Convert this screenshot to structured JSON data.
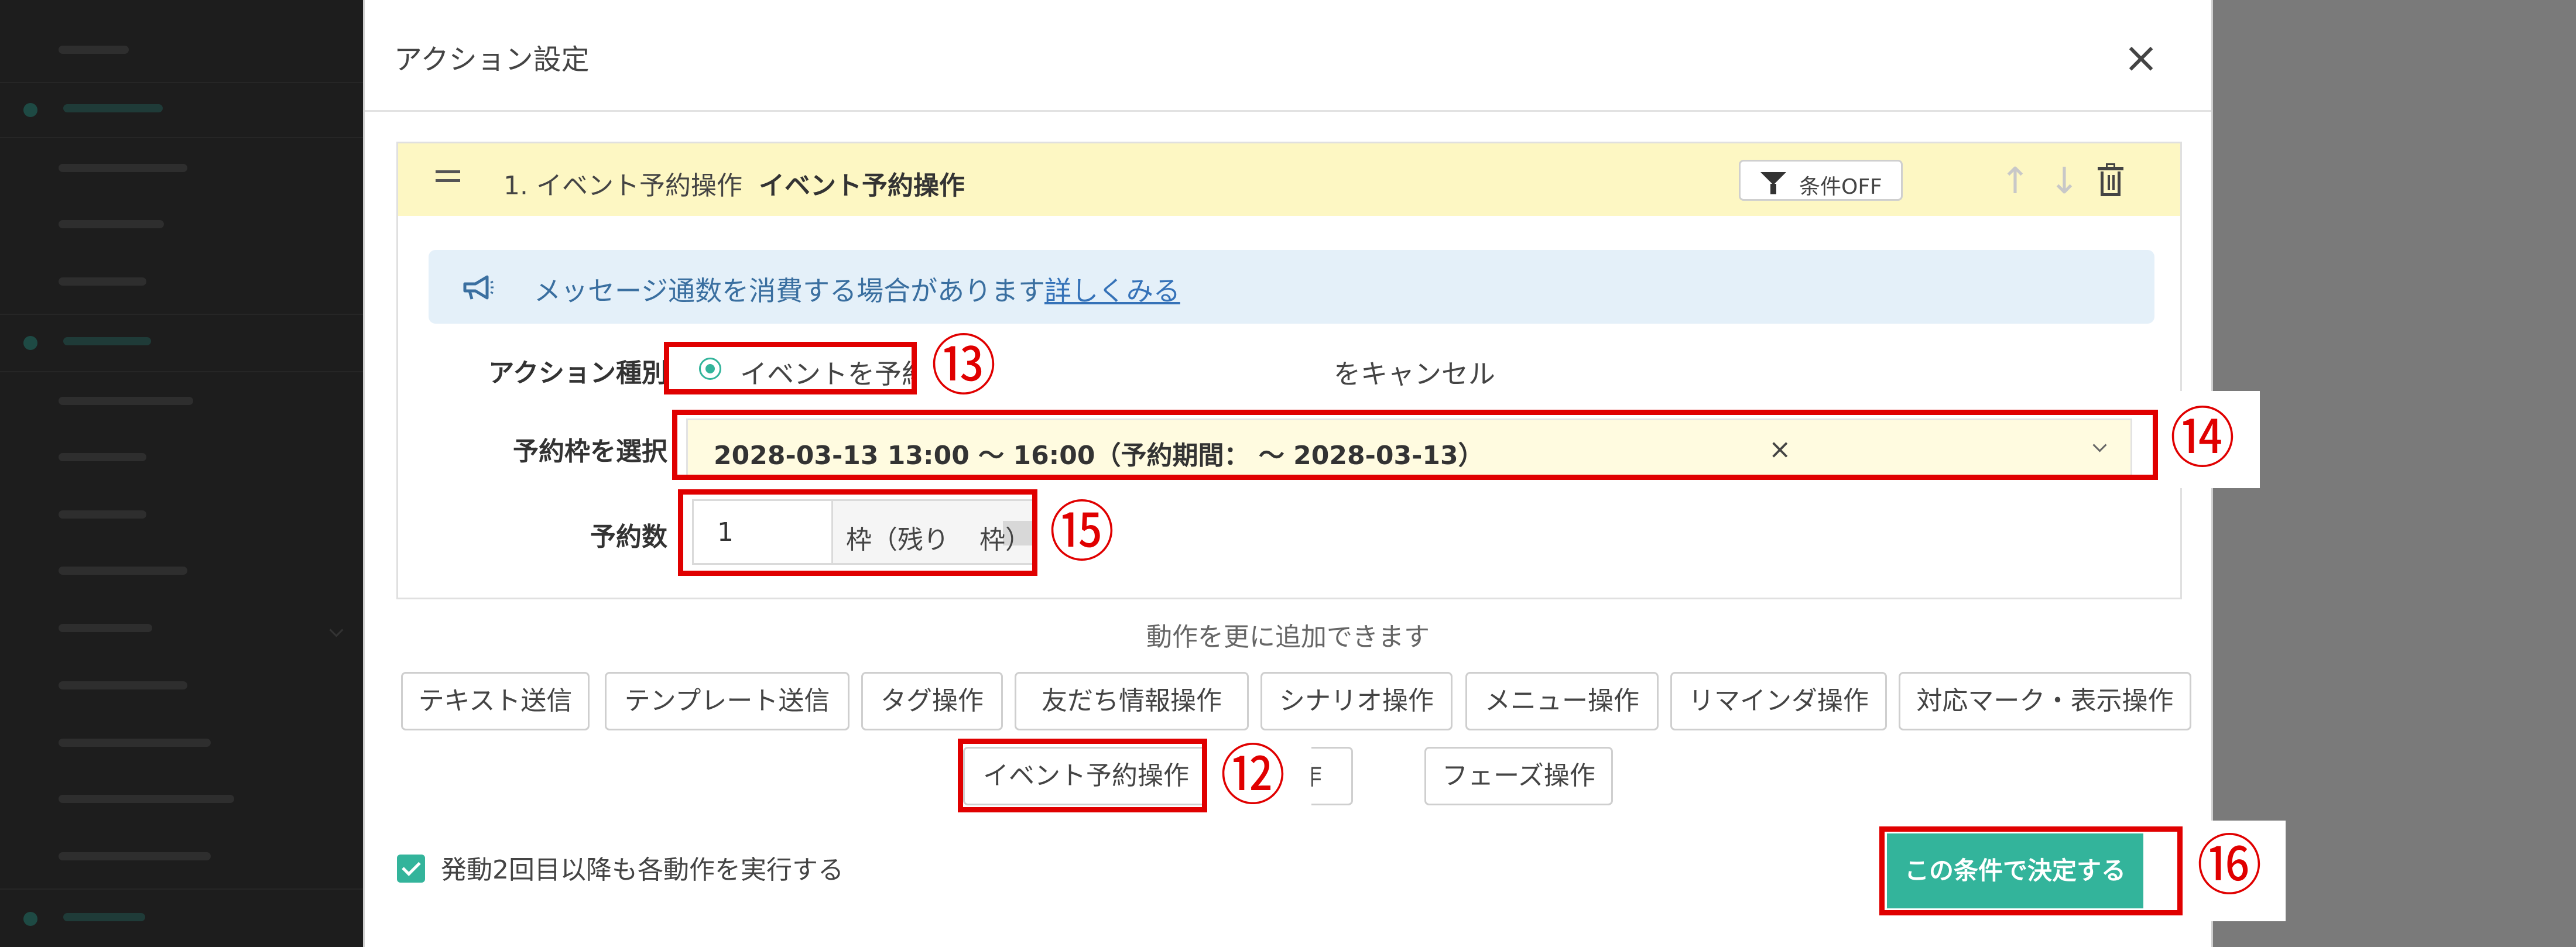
{
  "modal": {
    "title": "アクション設定",
    "close_glyph": "×"
  },
  "action": {
    "title_prefix": "1. イベント予約操作",
    "title_strong": "イベント予約操作",
    "condition_button": "条件OFF",
    "up_glyph": "↑",
    "down_glyph": "↓"
  },
  "notice": {
    "text": "メッセージ通数を消費する場合があります",
    "link": "詳しくみる"
  },
  "form": {
    "action_type_label": "アクション種別",
    "radio_selected": "イベントを予約",
    "radio_other_visible": "をキャンセル",
    "slot_label": "予約枠を選択",
    "slot_value": "2028-03-13 13:00 〜 16:00（予約期間： 〜 2028-03-13）",
    "clear_glyph": "×",
    "count_label": "予約数",
    "count_value": "1",
    "count_suffix_start": "枠（残り",
    "count_suffix_end": "枠）"
  },
  "operations": {
    "hint": "動作を更に追加できます",
    "row1": [
      "テキスト送信",
      "テンプレート送信",
      "タグ操作",
      "友だち情報操作",
      "シナリオ操作",
      "メニュー操作",
      "リマインダ操作",
      "対応マーク・表示操作"
    ],
    "row2": [
      "イベント予約操作",
      "報操作",
      "フェーズ操作"
    ]
  },
  "footer": {
    "checkbox_label": "発動2回目以降も各動作を実行する",
    "submit": "この条件で決定する"
  },
  "annotations": {
    "n12": "⑫",
    "n13": "⑬",
    "n14": "⑭",
    "n15": "⑮",
    "n16": "⑯",
    "color": "#e00000"
  },
  "colors": {
    "accent": "#33b49b",
    "header_bg": "#fdf7c3",
    "notice_bg": "#e4f0f9",
    "sidebar_bg": "#1d1d1d"
  }
}
